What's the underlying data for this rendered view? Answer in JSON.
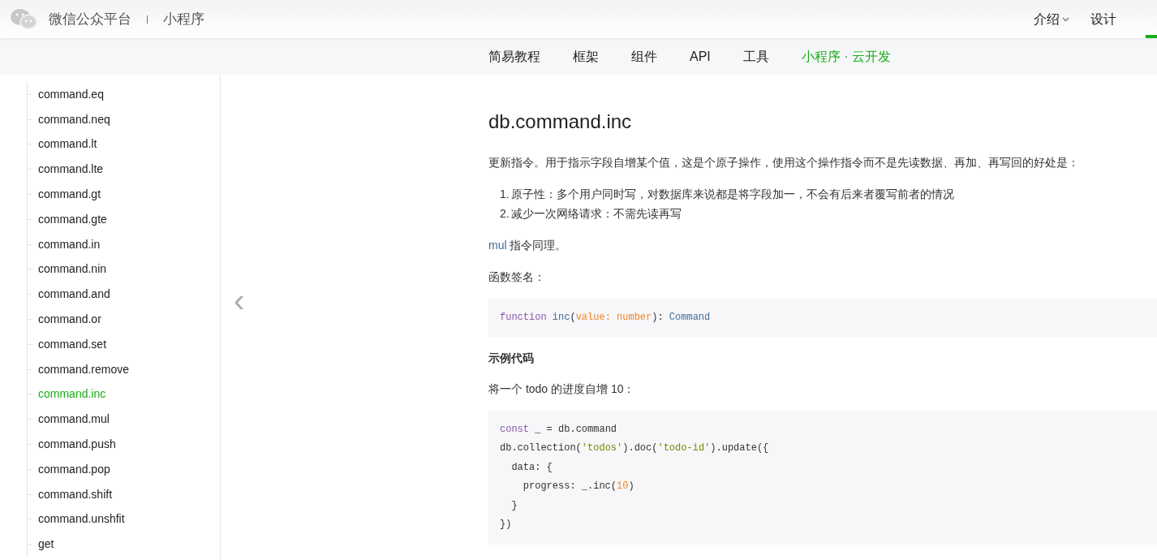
{
  "header": {
    "brand": "微信公众平台",
    "separator": "|",
    "product": "小程序",
    "links": [
      {
        "label": "介绍",
        "dropdown": true
      },
      {
        "label": "设计",
        "dropdown": false
      }
    ]
  },
  "subnav": [
    {
      "label": "简易教程",
      "selected": false
    },
    {
      "label": "框架",
      "selected": false
    },
    {
      "label": "组件",
      "selected": false
    },
    {
      "label": "API",
      "selected": false
    },
    {
      "label": "工具",
      "selected": false
    },
    {
      "label": "小程序 · 云开发",
      "selected": true
    }
  ],
  "sidebar": {
    "items": [
      {
        "label": "command.eq",
        "selected": false
      },
      {
        "label": "command.neq",
        "selected": false
      },
      {
        "label": "command.lt",
        "selected": false
      },
      {
        "label": "command.lte",
        "selected": false
      },
      {
        "label": "command.gt",
        "selected": false
      },
      {
        "label": "command.gte",
        "selected": false
      },
      {
        "label": "command.in",
        "selected": false
      },
      {
        "label": "command.nin",
        "selected": false
      },
      {
        "label": "command.and",
        "selected": false
      },
      {
        "label": "command.or",
        "selected": false
      },
      {
        "label": "command.set",
        "selected": false
      },
      {
        "label": "command.remove",
        "selected": false
      },
      {
        "label": "command.inc",
        "selected": true
      },
      {
        "label": "command.mul",
        "selected": false
      },
      {
        "label": "command.push",
        "selected": false
      },
      {
        "label": "command.pop",
        "selected": false
      },
      {
        "label": "command.shift",
        "selected": false
      },
      {
        "label": "command.unshfit",
        "selected": false
      },
      {
        "label": "get",
        "selected": false
      }
    ]
  },
  "prev_arrow": "‹",
  "article": {
    "title": "db.command.inc",
    "blocks": [
      {
        "kind": "paragraph",
        "text": "更新指令。用于指示字段自增某个值，这是个原子操作，使用这个操作指令而不是先读数据、再加、再写回的好处是："
      },
      {
        "kind": "list",
        "items": [
          {
            "number": "1.",
            "text": "原子性：多个用户同时写，对数据库来说都是将字段加一，不会有后来者覆写前者的情况"
          },
          {
            "number": "2.",
            "text": "减少一次网络请求：不需先读再写"
          }
        ]
      },
      {
        "kind": "linked",
        "link": "mul",
        "text": " 指令同理。"
      },
      {
        "kind": "paragraph",
        "text": "函数签名："
      },
      {
        "kind": "code",
        "lines": [
          [
            {
              "kind": "keyword",
              "s": "function"
            },
            {
              "kind": "fn",
              "s": " inc"
            },
            {
              "kind": "plain",
              "s": "("
            },
            {
              "kind": "param",
              "s": "value: number"
            },
            {
              "kind": "plain",
              "s": "): "
            },
            {
              "kind": "type",
              "s": "Command"
            }
          ]
        ]
      },
      {
        "kind": "heading",
        "text": "示例代码"
      },
      {
        "kind": "paragraph",
        "text": "将一个 todo 的进度自增 10："
      },
      {
        "kind": "code",
        "lines": [
          [
            {
              "kind": "keyword",
              "s": "const"
            },
            {
              "kind": "plain",
              "s": " _ = db.command"
            }
          ],
          [
            {
              "kind": "plain",
              "s": "db.collection("
            },
            {
              "kind": "string",
              "s": "'todos'"
            },
            {
              "kind": "plain",
              "s": ").doc("
            },
            {
              "kind": "string",
              "s": "'todo-id'"
            },
            {
              "kind": "plain",
              "s": ").update({"
            }
          ],
          [
            {
              "kind": "plain",
              "s": "  data: {"
            }
          ],
          [
            {
              "kind": "plain",
              "s": "    progress: _.inc("
            },
            {
              "kind": "number",
              "s": "10"
            },
            {
              "kind": "plain",
              "s": ")"
            }
          ],
          [
            {
              "kind": "plain",
              "s": "  }"
            }
          ],
          [
            {
              "kind": "plain",
              "s": "})"
            }
          ]
        ]
      }
    ]
  }
}
